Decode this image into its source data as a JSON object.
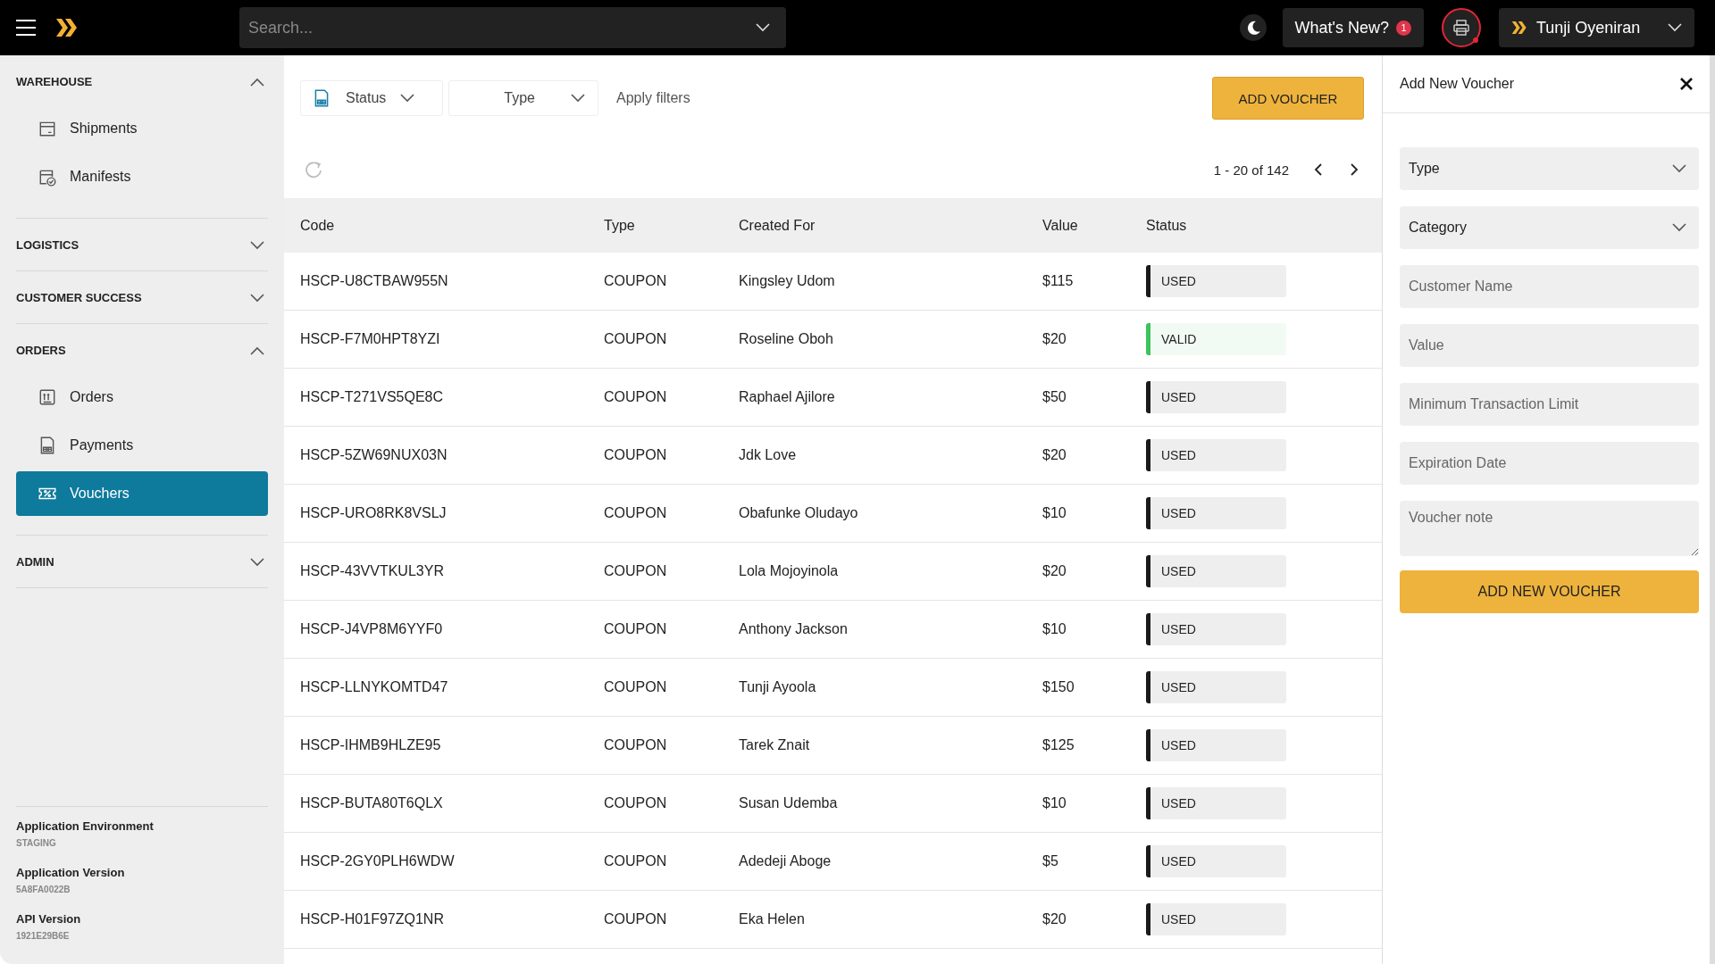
{
  "topbar": {
    "search_placeholder": "Search...",
    "whats_new": "What's New?",
    "whats_new_count": "1",
    "user_name": "Tunji Oyeniran"
  },
  "sidebar": {
    "sections": [
      {
        "title": "WAREHOUSE",
        "expanded": true,
        "items": [
          {
            "label": "Shipments",
            "selected": false
          },
          {
            "label": "Manifests",
            "selected": false
          }
        ]
      },
      {
        "title": "LOGISTICS",
        "expanded": false
      },
      {
        "title": "CUSTOMER SUCCESS",
        "expanded": false
      },
      {
        "title": "ORDERS",
        "expanded": true,
        "items": [
          {
            "label": "Orders",
            "selected": false
          },
          {
            "label": "Payments",
            "selected": false
          },
          {
            "label": "Vouchers",
            "selected": true
          }
        ]
      },
      {
        "title": "ADMIN",
        "expanded": false
      }
    ],
    "info": [
      {
        "label": "Application Environment",
        "value": "STAGING"
      },
      {
        "label": "Application Version",
        "value": "5A8FA0022B"
      },
      {
        "label": "API Version",
        "value": "1921E29B6E"
      }
    ]
  },
  "filters": {
    "status": "Status",
    "type": "Type",
    "apply": "Apply filters",
    "add_button": "ADD VOUCHER"
  },
  "pagination": "1 - 20 of 142",
  "table": {
    "columns": [
      "Code",
      "Type",
      "Created For",
      "Value",
      "Status"
    ],
    "rows": [
      {
        "code": "HSCP-U8CTBAW955N",
        "type": "COUPON",
        "created_for": "Kingsley Udom",
        "value": "$115",
        "status": "USED",
        "kind": "used"
      },
      {
        "code": "HSCP-F7M0HPT8YZI",
        "type": "COUPON",
        "created_for": "Roseline Oboh",
        "value": "$20",
        "status": "VALID",
        "kind": "valid"
      },
      {
        "code": "HSCP-T271VS5QE8C",
        "type": "COUPON",
        "created_for": "Raphael Ajilore",
        "value": "$50",
        "status": "USED",
        "kind": "used"
      },
      {
        "code": "HSCP-5ZW69NUX03N",
        "type": "COUPON",
        "created_for": "Jdk Love",
        "value": "$20",
        "status": "USED",
        "kind": "used"
      },
      {
        "code": "HSCP-URO8RK8VSLJ",
        "type": "COUPON",
        "created_for": "Obafunke Oludayo",
        "value": "$10",
        "status": "USED",
        "kind": "used"
      },
      {
        "code": "HSCP-43VVTKUL3YR",
        "type": "COUPON",
        "created_for": "Lola Mojoyinola",
        "value": "$20",
        "status": "USED",
        "kind": "used"
      },
      {
        "code": "HSCP-J4VP8M6YYF0",
        "type": "COUPON",
        "created_for": "Anthony Jackson",
        "value": "$10",
        "status": "USED",
        "kind": "used"
      },
      {
        "code": "HSCP-LLNYKOMTD47",
        "type": "COUPON",
        "created_for": "Tunji Ayoola",
        "value": "$150",
        "status": "USED",
        "kind": "used"
      },
      {
        "code": "HSCP-IHMB9HLZE95",
        "type": "COUPON",
        "created_for": "Tarek Znait",
        "value": "$125",
        "status": "USED",
        "kind": "used"
      },
      {
        "code": "HSCP-BUTA80T6QLX",
        "type": "COUPON",
        "created_for": "Susan Udemba",
        "value": "$10",
        "status": "USED",
        "kind": "used"
      },
      {
        "code": "HSCP-2GY0PLH6WDW",
        "type": "COUPON",
        "created_for": "Adedeji Aboge",
        "value": "$5",
        "status": "USED",
        "kind": "used"
      },
      {
        "code": "HSCP-H01F97ZQ1NR",
        "type": "COUPON",
        "created_for": "Eka Helen",
        "value": "$20",
        "status": "USED",
        "kind": "used"
      }
    ]
  },
  "panel": {
    "title": "Add New Voucher",
    "fields": [
      {
        "kind": "select",
        "placeholder": "Type"
      },
      {
        "kind": "select",
        "placeholder": "Category"
      },
      {
        "kind": "text",
        "placeholder": "Customer Name"
      },
      {
        "kind": "text",
        "placeholder": "Value"
      },
      {
        "kind": "text",
        "placeholder": "Minimum Transaction Limit"
      },
      {
        "kind": "text",
        "placeholder": "Expiration Date"
      },
      {
        "kind": "textarea",
        "placeholder": "Voucher note"
      }
    ],
    "submit": "ADD NEW VOUCHER"
  }
}
